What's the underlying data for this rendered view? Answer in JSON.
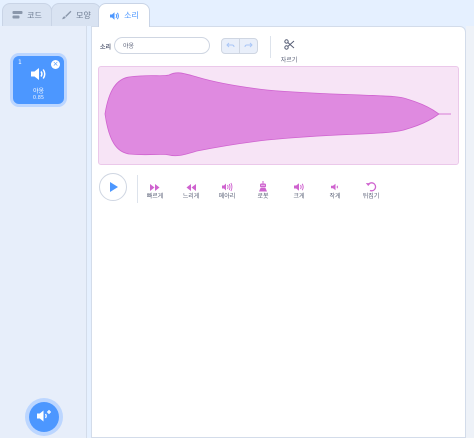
{
  "tabs": [
    {
      "label": "코드",
      "icon": "code-icon",
      "active": false
    },
    {
      "label": "모양",
      "icon": "paintbrush-icon",
      "active": false
    },
    {
      "label": "소리",
      "icon": "speaker-icon",
      "active": true
    }
  ],
  "sound_list": {
    "items": [
      {
        "index": "1",
        "name": "야옹",
        "duration": "0.85",
        "selected": true
      }
    ],
    "add_button_icon": "add-sound-icon"
  },
  "editor": {
    "sound_label": "소리",
    "sound_name": "야옹",
    "undo_icon": "undo-icon",
    "redo_icon": "redo-icon",
    "trim_label": "자르기",
    "colors": {
      "accent": "#4c97ff",
      "waveform": "#df8ae0",
      "waveform_bg": "#f7e4f6",
      "effect_icon": "#cf63cf"
    },
    "effects": [
      {
        "label": "빠르게",
        "icon": "faster-icon"
      },
      {
        "label": "느리게",
        "icon": "slower-icon"
      },
      {
        "label": "메아리",
        "icon": "echo-icon"
      },
      {
        "label": "로봇",
        "icon": "robot-icon"
      },
      {
        "label": "크게",
        "icon": "louder-icon"
      },
      {
        "label": "작게",
        "icon": "softer-icon"
      },
      {
        "label": "뒤집기",
        "icon": "reverse-icon"
      }
    ]
  }
}
